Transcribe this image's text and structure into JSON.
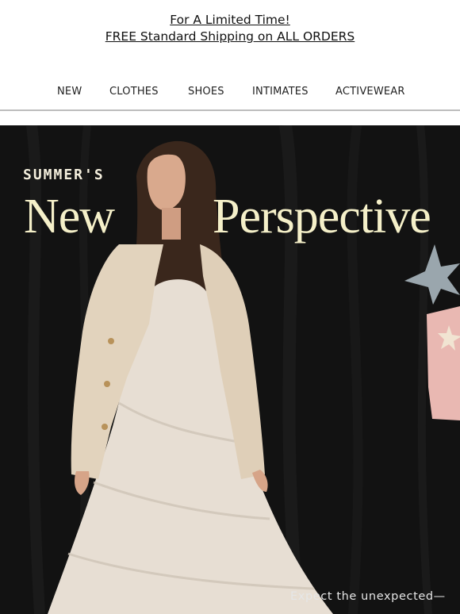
{
  "promo": {
    "line1": "For A Limited Time!",
    "line2": "FREE Standard Shipping on ALL ORDERS"
  },
  "nav": {
    "items": [
      {
        "label": "NEW"
      },
      {
        "label": "CLOTHES"
      },
      {
        "label": "SHOES"
      },
      {
        "label": "INTIMATES"
      },
      {
        "label": "ACTIVEWEAR"
      }
    ]
  },
  "hero": {
    "eyebrow": "SUMMER'S",
    "title_word1": "New",
    "title_word2": "Perspective",
    "blurb_line1": "Expect the unexpected—",
    "blurb_line2": "",
    "colors": {
      "background": "#111111",
      "title": "#f5f0c9",
      "dress": "#e7ded3",
      "jacket": "#e2d3bd"
    }
  }
}
